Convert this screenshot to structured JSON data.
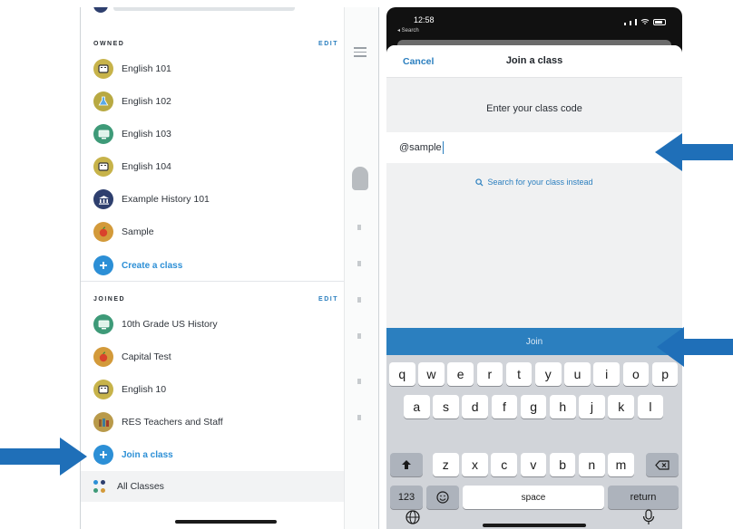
{
  "sidebar": {
    "owned_header": "OWNED",
    "owned_edit": "EDIT",
    "owned_items": [
      {
        "label": "English 101",
        "icon": "book-icon",
        "color": "#c7b34a"
      },
      {
        "label": "English 102",
        "icon": "flask-icon",
        "color": "#b8a942"
      },
      {
        "label": "English 103",
        "icon": "computer-icon",
        "color": "#3e9a78"
      },
      {
        "label": "English 104",
        "icon": "book-icon",
        "color": "#c7b34a"
      },
      {
        "label": "Example History 101",
        "icon": "building-icon",
        "color": "#2e3f6e"
      },
      {
        "label": "Sample",
        "icon": "apple-icon",
        "color": "#d39a3a"
      }
    ],
    "create_label": "Create a class",
    "joined_header": "JOINED",
    "joined_edit": "EDIT",
    "joined_items": [
      {
        "label": "10th Grade US History",
        "icon": "computer-icon",
        "color": "#3e9a78"
      },
      {
        "label": "Capital Test",
        "icon": "apple-icon",
        "color": "#d39a3a"
      },
      {
        "label": "English 10",
        "icon": "book-icon",
        "color": "#c7b34a"
      },
      {
        "label": "RES Teachers and Staff",
        "icon": "books-icon",
        "color": "#b99a4a"
      }
    ],
    "join_label": "Join a class",
    "all_classes_label": "All Classes"
  },
  "status_bar": {
    "time": "12:58",
    "back_label": "◂ Search"
  },
  "join_sheet": {
    "cancel_label": "Cancel",
    "title": "Join a class",
    "prompt": "Enter your class code",
    "code_value": "@sample",
    "search_link": "Search for your class instead",
    "join_button": "Join"
  },
  "keyboard": {
    "row1": [
      "q",
      "w",
      "e",
      "r",
      "t",
      "y",
      "u",
      "i",
      "o",
      "p"
    ],
    "row2": [
      "a",
      "s",
      "d",
      "f",
      "g",
      "h",
      "j",
      "k",
      "l"
    ],
    "row3": [
      "z",
      "x",
      "c",
      "v",
      "b",
      "n",
      "m"
    ],
    "numbers_key": "123",
    "space_key": "space",
    "return_key": "return"
  },
  "colors": {
    "accent": "#2b7fbf",
    "arrow": "#1f6fb8"
  }
}
